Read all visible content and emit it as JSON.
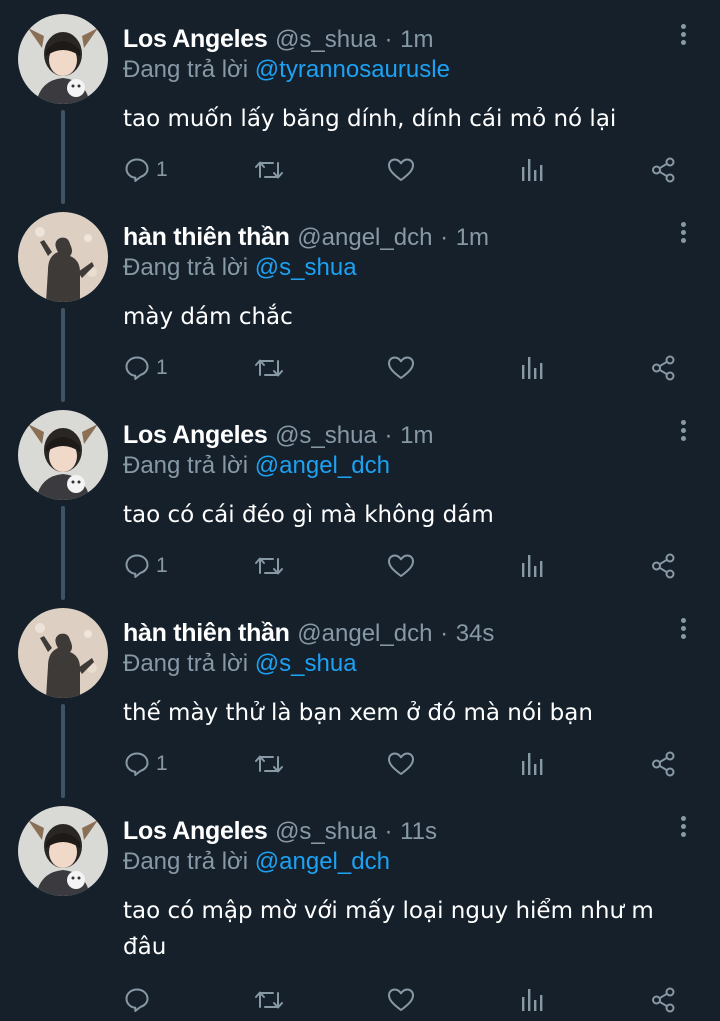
{
  "tweets": [
    {
      "name": "Los Angeles",
      "handle": "@s_shua",
      "time": "1m",
      "replying_prefix": "Đang trả lời ",
      "replying_to": "@tyrannosaurusle",
      "text": "tao muốn lấy băng dính, dính cái mỏ nó lại",
      "reply_count": "1",
      "avatar": "person-deer-ears"
    },
    {
      "name": "hàn thiên thần",
      "handle": "@angel_dch",
      "time": "1m",
      "replying_prefix": "Đang trả lời ",
      "replying_to": "@s_shua",
      "text": "mày dám chắc",
      "reply_count": "1",
      "avatar": "shadow-silhouette"
    },
    {
      "name": "Los Angeles",
      "handle": "@s_shua",
      "time": "1m",
      "replying_prefix": "Đang trả lời ",
      "replying_to": "@angel_dch",
      "text": "tao có cái đéo gì mà không dám",
      "reply_count": "1",
      "avatar": "person-deer-ears"
    },
    {
      "name": "hàn thiên thần",
      "handle": "@angel_dch",
      "time": "34s",
      "replying_prefix": "Đang trả lời ",
      "replying_to": "@s_shua",
      "text": "thế mày thử là bạn xem ở đó mà nói bạn",
      "reply_count": "1",
      "avatar": "shadow-silhouette"
    },
    {
      "name": "Los Angeles",
      "handle": "@s_shua",
      "time": "11s",
      "replying_prefix": "Đang trả lời ",
      "replying_to": "@angel_dch",
      "text": "tao có mập mờ với mấy loại nguy hiểm như m đâu",
      "reply_count": "",
      "avatar": "person-deer-ears"
    }
  ],
  "separator": "·",
  "colors": {
    "background": "#15202b",
    "secondary_text": "#8899a6",
    "link": "#1da1f2",
    "thread_line": "#3d5466"
  },
  "icons": [
    "reply-icon",
    "retweet-icon",
    "like-icon",
    "analytics-icon",
    "share-icon",
    "more-options-icon"
  ]
}
